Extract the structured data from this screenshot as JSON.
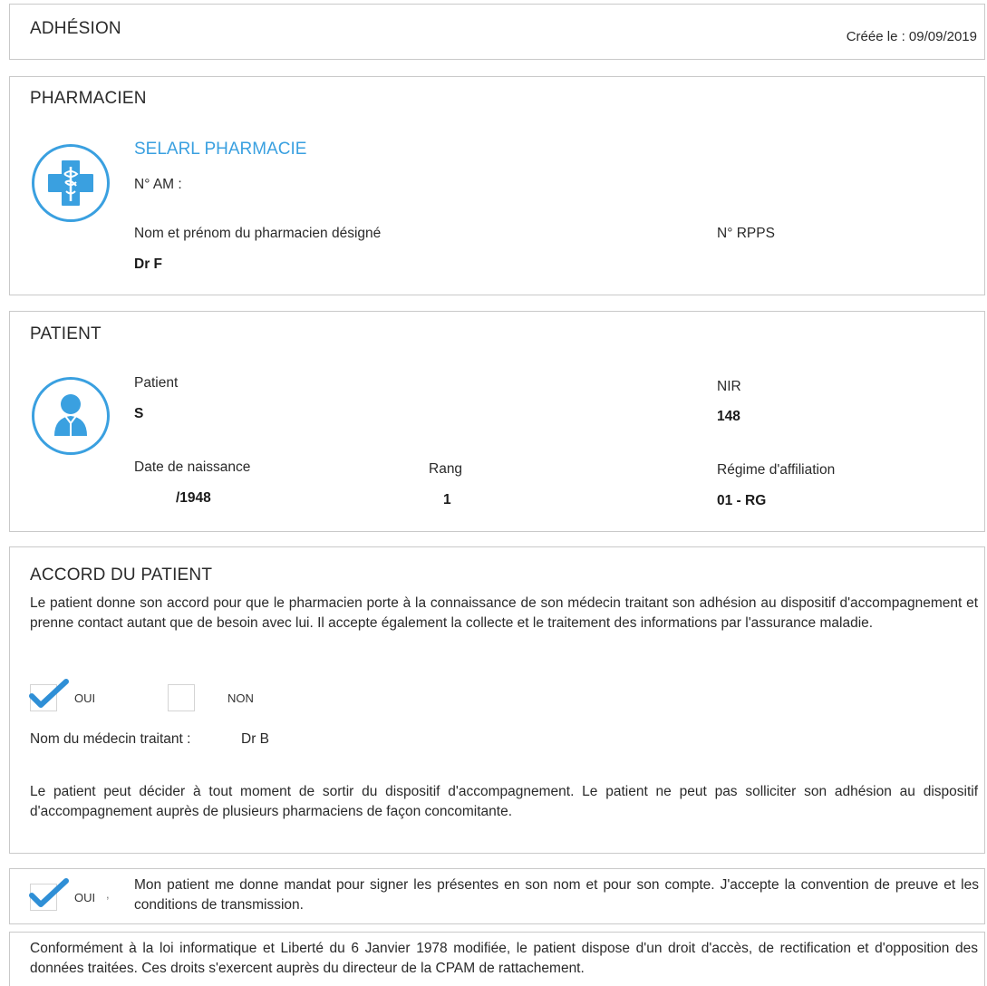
{
  "header": {
    "title": "ADHÉSION",
    "created": "Créée le : 09/09/2019"
  },
  "pharmacien": {
    "section_title": "PHARMACIEN",
    "name": "SELARL PHARMACIE",
    "am_label": "N° AM :",
    "designated_label": "Nom et prénom du pharmacien désigné",
    "designated_value": "Dr F",
    "rpps_label": "N° RPPS",
    "icon": "pharmacy-cross-icon"
  },
  "patient": {
    "section_title": "PATIENT",
    "patient_label": "Patient",
    "patient_value": "S",
    "nir_label": "NIR",
    "nir_value": "148",
    "dob_label": "Date de naissance",
    "dob_value": "/1948",
    "rang_label": "Rang",
    "rang_value": "1",
    "regime_label": "Régime d'affiliation",
    "regime_value": "01 - RG",
    "icon": "person-icon"
  },
  "accord": {
    "section_title": "ACCORD DU PATIENT",
    "paragraph1": "Le patient donne son accord pour que le pharmacien porte à la connaissance de son médecin traitant son adhésion au dispositif d'accompagnement et prenne contact autant que de besoin avec lui. Il accepte également la collecte et le traitement des informations par l'assurance maladie.",
    "oui_label": "OUI",
    "non_label": "NON",
    "oui_checked": true,
    "non_checked": false,
    "medecin_label": "Nom du médecin traitant :",
    "medecin_value": "Dr B",
    "paragraph2": "Le patient peut décider à tout moment de sortir du dispositif d'accompagnement. Le patient ne peut pas solliciter son adhésion au dispositif d'accompagnement auprès de plusieurs pharmaciens de façon concomitante."
  },
  "mandat": {
    "oui_label": "OUI",
    "oui_mark": ",",
    "checked": true,
    "text": "Mon patient me donne mandat pour signer les présentes en son nom et pour son compte. J'accepte la convention de preuve et les conditions de transmission."
  },
  "footer": {
    "text": "Conformément à la loi informatique et Liberté du 6 Janvier 1978 modifiée, le patient dispose d'un droit d'accès, de rectification et d'opposition des données traitées. Ces droits s'exercent auprès du directeur de la CPAM de rattachement."
  },
  "colors": {
    "accent": "#3aa0e0",
    "border": "#c9c9c9",
    "text": "#2a2a2a"
  }
}
